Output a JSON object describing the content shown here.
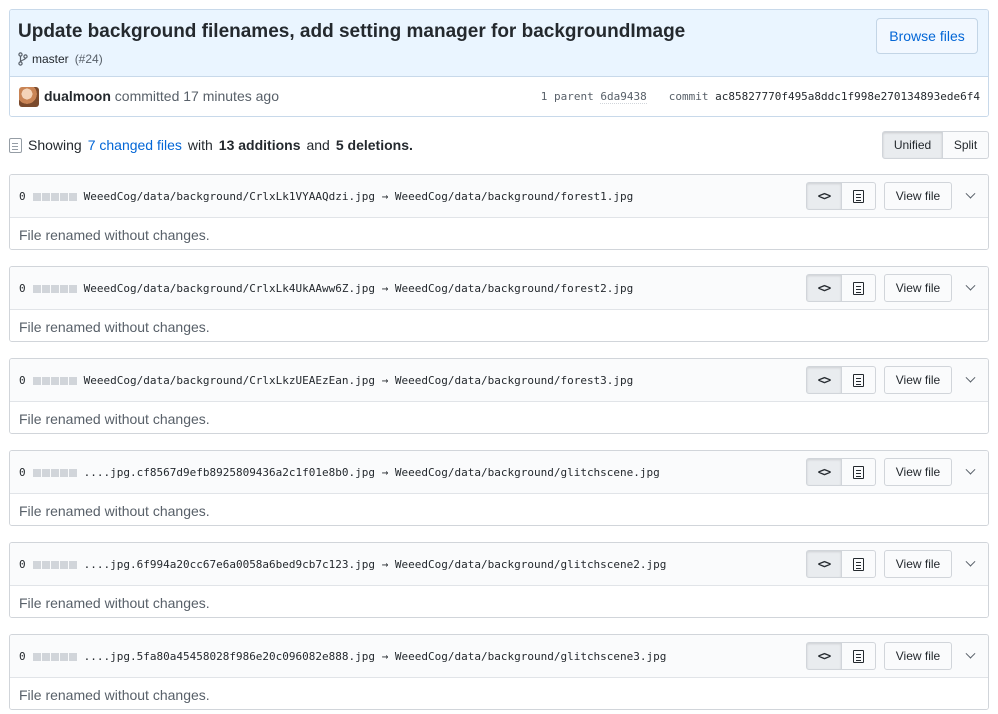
{
  "commit": {
    "title": "Update background filenames, add setting manager for backgroundImage",
    "branch": "master",
    "pr_ref": "(#24)",
    "browse_label": "Browse files",
    "author": "dualmoon",
    "committed_text": "committed 17 minutes ago",
    "parent_label": "1 parent",
    "parent_sha": "6da9438",
    "commit_label": "commit",
    "commit_sha": "ac85827770f495a8ddc1f998e270134893ede6f4"
  },
  "toc": {
    "showing": "Showing",
    "changed_files": "7 changed files",
    "with": "with",
    "additions": "13 additions",
    "and": "and",
    "deletions": "5 deletions.",
    "unified_label": "Unified",
    "split_label": "Split"
  },
  "files": [
    {
      "count": "0",
      "path": "WeeedCog/data/background/CrlxLk1VYAAQdzi.jpg → WeeedCog/data/background/forest1.jpg",
      "view_label": "View file",
      "message": "File renamed without changes."
    },
    {
      "count": "0",
      "path": "WeeedCog/data/background/CrlxLk4UkAAww6Z.jpg → WeeedCog/data/background/forest2.jpg",
      "view_label": "View file",
      "message": "File renamed without changes."
    },
    {
      "count": "0",
      "path": "WeeedCog/data/background/CrlxLkzUEAEzEan.jpg → WeeedCog/data/background/forest3.jpg",
      "view_label": "View file",
      "message": "File renamed without changes."
    },
    {
      "count": "0",
      "path": "....jpg.cf8567d9efb8925809436a2c1f01e8b0.jpg → WeeedCog/data/background/glitchscene.jpg",
      "view_label": "View file",
      "message": "File renamed without changes."
    },
    {
      "count": "0",
      "path": "....jpg.6f994a20cc67e6a0058a6bed9cb7c123.jpg → WeeedCog/data/background/glitchscene2.jpg",
      "view_label": "View file",
      "message": "File renamed without changes."
    },
    {
      "count": "0",
      "path": "....jpg.5fa80a45458028f986e20c096082e888.jpg → WeeedCog/data/background/glitchscene3.jpg",
      "view_label": "View file",
      "message": "File renamed without changes."
    }
  ]
}
